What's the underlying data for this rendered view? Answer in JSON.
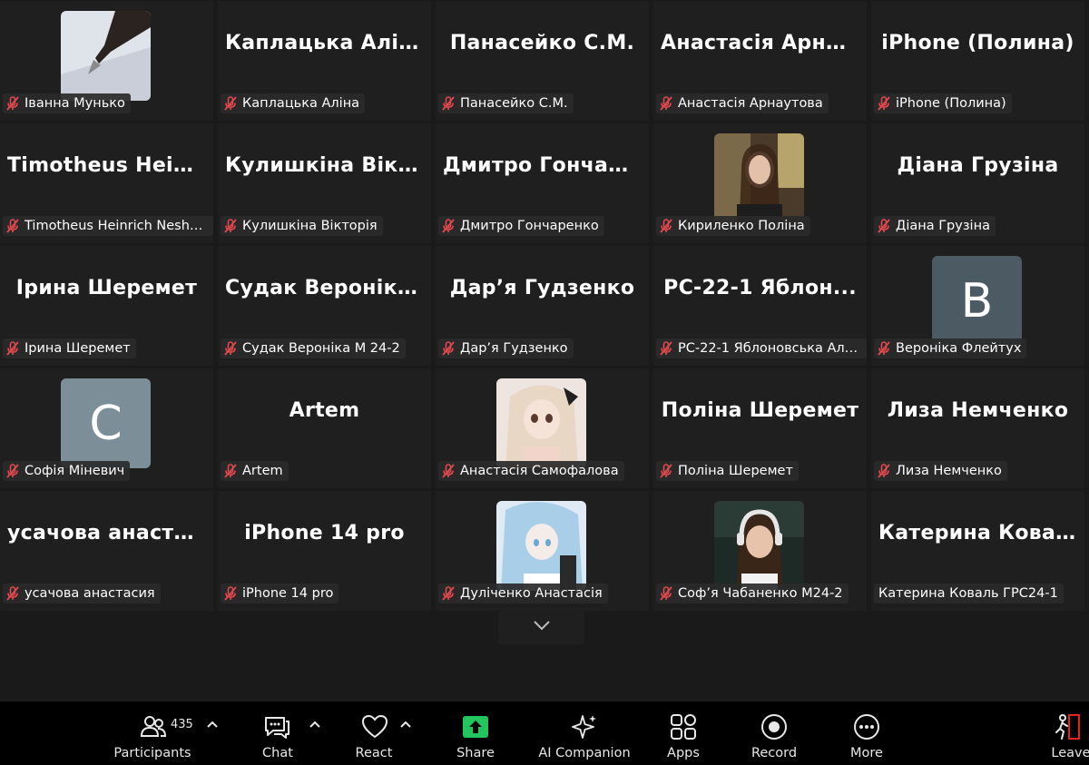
{
  "participants": [
    {
      "name": "Іванна Мунько",
      "tile_title": "",
      "avatar": "photo-pen"
    },
    {
      "name": "Каплацька Аліна",
      "tile_title": "Каплацька Аліна"
    },
    {
      "name": "Панасейко С.М.",
      "tile_title": "Панасейко С.М."
    },
    {
      "name": "Анастасія Арнаутова",
      "tile_title": "Анастасія Арна..."
    },
    {
      "name": "iPhone (Полина)",
      "tile_title": "iPhone (Полина)"
    },
    {
      "name": "Timotheus Heinrich Neshcha...",
      "tile_title": "Timotheus Hein..."
    },
    {
      "name": "Кулишкіна Вікторія",
      "tile_title": "Кулишкіна Вікт..."
    },
    {
      "name": "Дмитро Гончаренко",
      "tile_title": "Дмитро Гончар..."
    },
    {
      "name": "Кириленко Поліна",
      "tile_title": "",
      "avatar": "photo-girl-dark"
    },
    {
      "name": "Діана Грузіна",
      "tile_title": "Діана Грузіна"
    },
    {
      "name": "Ірина Шеремет",
      "tile_title": "Ірина Шеремет"
    },
    {
      "name": "Судак Вероніка М 24-2",
      "tile_title": "Судак Вероніка..."
    },
    {
      "name": "Дар’я Гудзенко",
      "tile_title": "Дар’я Гудзенко"
    },
    {
      "name": "РС-22-1 Яблоновська Аліса",
      "tile_title": "РС-22-1 Яблон..."
    },
    {
      "name": "Вероніка Флейтух",
      "tile_title": "",
      "avatar": "letter",
      "letter": "В",
      "avatar_color": "#4b5a63"
    },
    {
      "name": "Софія Міневич",
      "tile_title": "",
      "avatar": "letter",
      "letter": "C",
      "avatar_color": "#7c8f99"
    },
    {
      "name": "Artem",
      "tile_title": "Artem"
    },
    {
      "name": "Анастасія Самофалова",
      "tile_title": "",
      "avatar": "photo-anime-doll"
    },
    {
      "name": "Поліна Шеремет",
      "tile_title": "Поліна Шеремет"
    },
    {
      "name": "Лиза Немченко",
      "tile_title": "Лиза Немченко"
    },
    {
      "name": "усачова анастасия",
      "tile_title": "усачова анаста..."
    },
    {
      "name": "iPhone 14 pro",
      "tile_title": "iPhone 14 pro"
    },
    {
      "name": "Дуліченко Анастасія",
      "tile_title": "",
      "avatar": "photo-anime-blue"
    },
    {
      "name": "Соф’я Чабаненко М24-2",
      "tile_title": "",
      "avatar": "photo-girl-headphones"
    },
    {
      "name": "Катерина Коваль ГРС24-1",
      "tile_title": "Катерина Кова...",
      "muted": false
    }
  ],
  "toolbar": {
    "participants_label": "Participants",
    "participants_count": "435",
    "chat_label": "Chat",
    "react_label": "React",
    "share_label": "Share",
    "ai_label": "AI Companion",
    "apps_label": "Apps",
    "record_label": "Record",
    "more_label": "More",
    "leave_label": "Leave"
  },
  "colors": {
    "mute_red": "#e5484d",
    "share_green": "#22c55e",
    "leave_red": "#e02424"
  }
}
